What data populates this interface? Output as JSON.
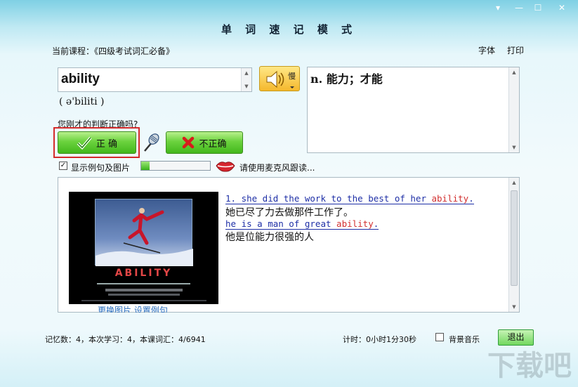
{
  "window": {
    "title": "单 词 速 记 模 式",
    "controls": [
      "▾",
      "—",
      "☐",
      "✕"
    ]
  },
  "header": {
    "course_label": "当前课程：《四级考试词汇必备》",
    "font_link": "字体",
    "print_link": "打印"
  },
  "word": {
    "text": "ability",
    "phonetic": "( ə'biliti )",
    "speak_label": "慢"
  },
  "definition": "n. 能力；才能",
  "judgement": {
    "question": "您刚才的判断正确吗?",
    "correct_label": "正 确",
    "incorrect_label": "不正确"
  },
  "options": {
    "show_examples_label": "显示例句及图片",
    "show_examples_checked": true,
    "record_progress_percent": 12,
    "read_hint": "请使用麦克风跟读..."
  },
  "examples": {
    "ex1_prefix": "1. she did the work to the best of her ",
    "ex1_keyword": "ability",
    "ex1_suffix": ".",
    "ex1_translation": "她已尽了力去做那件工作了。",
    "ex2_prefix": "he is a man of great ",
    "ex2_keyword": "ability",
    "ex2_suffix": ".",
    "ex2_translation": "他是位能力很强的人",
    "image_caption": "ABILITY",
    "image_links": "更换图片  设置例句"
  },
  "status": {
    "memory": "记忆数：4，本次学习：4，本课词汇：4/6941",
    "timer": "计时：0小时1分30秒",
    "bgm_label": "背景音乐",
    "bgm_checked": false,
    "exit_label": "退出"
  },
  "colors": {
    "accent_green": "#43b81c",
    "highlight_red": "#d42a2a",
    "link_blue": "#1e2fa6"
  }
}
